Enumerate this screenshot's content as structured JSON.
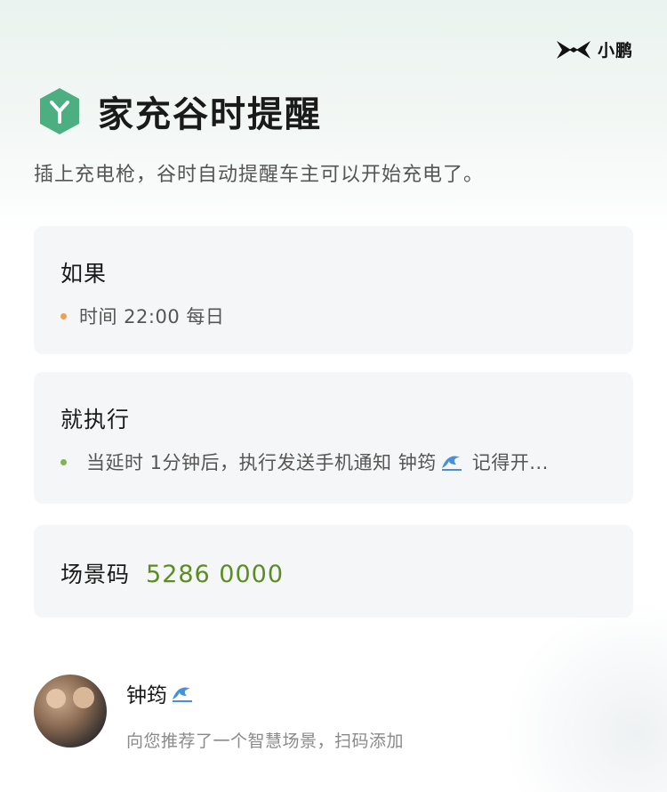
{
  "brand": {
    "name": "小鹏"
  },
  "header": {
    "title": "家充谷时提醒",
    "subtitle": "插上充电枪，谷时自动提醒车主可以开始充电了。"
  },
  "condition": {
    "heading": "如果",
    "item": "时间 22:00 每日"
  },
  "action": {
    "heading": "就执行",
    "item_prefix": "当延时 1分钟后，执行发送手机通知 钟筠",
    "item_suffix": "记得开..."
  },
  "scene_code": {
    "label": "场景码",
    "value": "5286 0000"
  },
  "sharer": {
    "name": "钟筠",
    "message": "向您推荐了一个智慧场景，扫码添加"
  },
  "colors": {
    "accent_green": "#5b8d22",
    "logo_green": "#4caf82",
    "dot_orange": "#e8a25a",
    "dot_green": "#7fb35a"
  },
  "icons": {
    "brand_logo": "xpeng-x-icon",
    "scene_logo": "hexagon-y-icon",
    "emoji": "wave-emoji-icon"
  }
}
